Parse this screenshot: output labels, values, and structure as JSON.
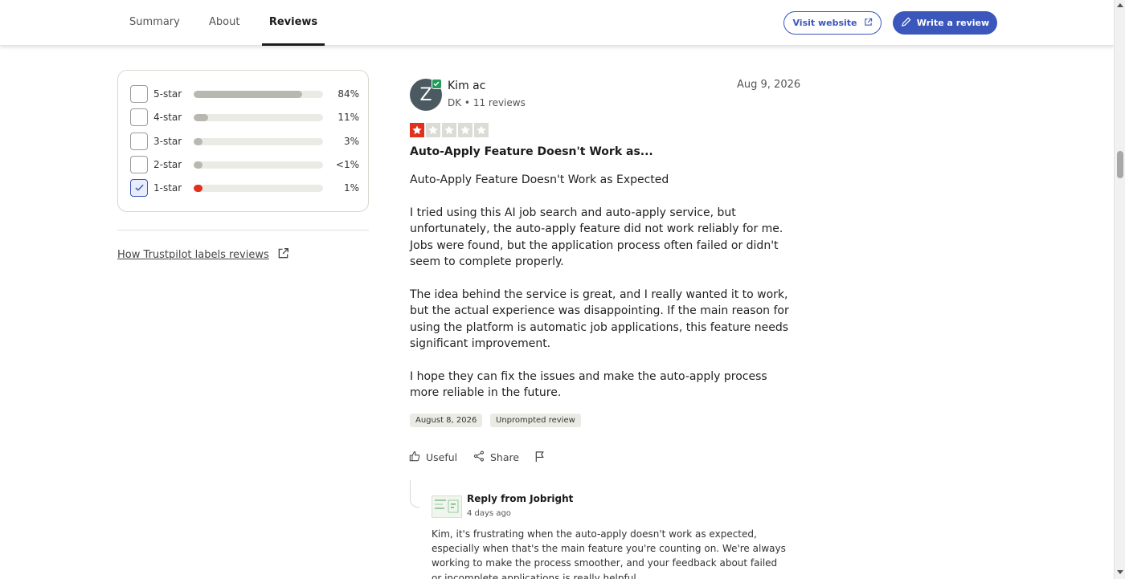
{
  "nav": {
    "tabs": [
      {
        "label": "Summary",
        "active": false
      },
      {
        "label": "About",
        "active": false
      },
      {
        "label": "Reviews",
        "active": true
      }
    ],
    "visit_label": "Visit website",
    "write_label": "Write a review",
    "accent_color": "#3c57bc"
  },
  "filters": {
    "rows": [
      {
        "label": "5-star",
        "percent": "84%",
        "fill": 0.84,
        "checked": false
      },
      {
        "label": "4-star",
        "percent": "11%",
        "fill": 0.11,
        "checked": false
      },
      {
        "label": "3-star",
        "percent": "3%",
        "fill": 0.03,
        "checked": false
      },
      {
        "label": "2-star",
        "percent": "<1%",
        "fill": 0.01,
        "checked": false
      },
      {
        "label": "1-star",
        "percent": "1%",
        "fill": 0.01,
        "checked": true
      }
    ],
    "labels_link": "How Trustpilot labels reviews"
  },
  "review": {
    "avatar_letter": "Z",
    "name": "Kim ac",
    "meta": "DK • 11 reviews",
    "date": "Aug 9, 2026",
    "rating": 1,
    "star_color": "#e0301e",
    "title": "Auto-Apply Feature Doesn't Work as...",
    "body": [
      "Auto-Apply Feature Doesn't Work as Expected",
      "I tried using this AI job search and auto-apply service, but unfortunately, the auto-apply feature did not work reliably for me. Jobs were found, but the application process often failed or didn't seem to complete properly.",
      "The idea behind the service is great, and I really wanted it to work, but the actual experience was disappointing. If the main reason for using the platform is automatic job applications, this feature needs significant improvement.",
      "I hope they can fix the issues and make the auto-apply process more reliable in the future."
    ],
    "experience_date": "August 8, 2026",
    "tag": "Unprompted review",
    "useful_label": "Useful",
    "share_label": "Share"
  },
  "reply": {
    "from": "Reply from Jobright",
    "when": "4 days ago",
    "body": "Kim, it's frustrating when the auto-apply doesn't work as expected, especially when that's the main feature you're counting on. We're always working to make the process smoother, and your feedback about failed or incomplete applications is really helpful."
  }
}
